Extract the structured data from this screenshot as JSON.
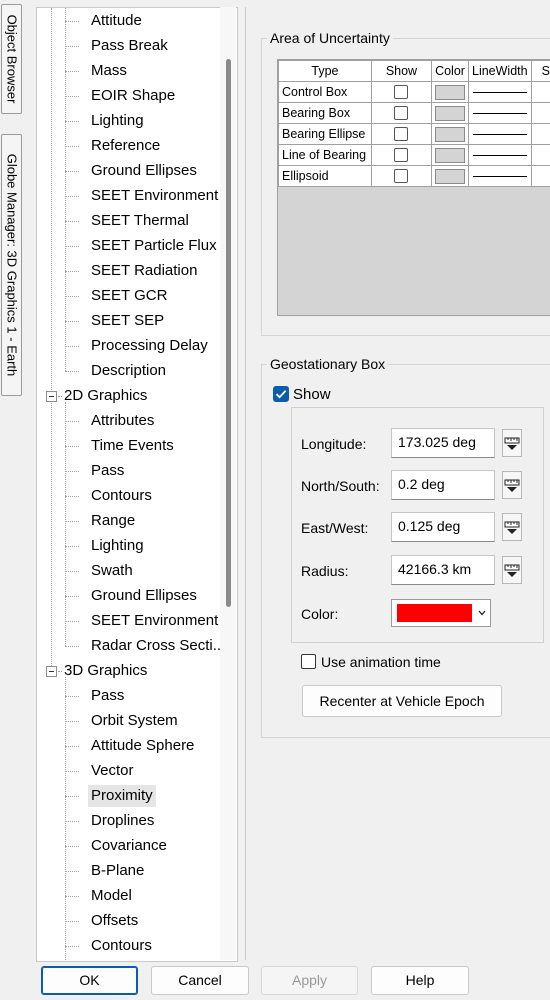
{
  "side_tabs": [
    "Object Browser",
    "Globe Manager: 3D Graphics 1 - Earth"
  ],
  "tree": {
    "items": [
      {
        "label": "Attitude",
        "level": 1
      },
      {
        "label": "Pass Break",
        "level": 1
      },
      {
        "label": "Mass",
        "level": 1
      },
      {
        "label": "EOIR Shape",
        "level": 1
      },
      {
        "label": "Lighting",
        "level": 1
      },
      {
        "label": "Reference",
        "level": 1
      },
      {
        "label": "Ground Ellipses",
        "level": 1
      },
      {
        "label": "SEET Environment",
        "level": 1
      },
      {
        "label": "SEET Thermal",
        "level": 1
      },
      {
        "label": "SEET Particle Flux",
        "level": 1
      },
      {
        "label": "SEET Radiation",
        "level": 1
      },
      {
        "label": "SEET GCR",
        "level": 1
      },
      {
        "label": "SEET SEP",
        "level": 1
      },
      {
        "label": "Processing Delay",
        "level": 1
      },
      {
        "label": "Description",
        "level": 1
      },
      {
        "label": "2D Graphics",
        "level": 0
      },
      {
        "label": "Attributes",
        "level": 1
      },
      {
        "label": "Time Events",
        "level": 1
      },
      {
        "label": "Pass",
        "level": 1
      },
      {
        "label": "Contours",
        "level": 1
      },
      {
        "label": "Range",
        "level": 1
      },
      {
        "label": "Lighting",
        "level": 1
      },
      {
        "label": "Swath",
        "level": 1
      },
      {
        "label": "Ground Ellipses",
        "level": 1
      },
      {
        "label": "SEET Environment",
        "level": 1
      },
      {
        "label": "Radar Cross Secti...",
        "level": 1
      },
      {
        "label": "3D Graphics",
        "level": 0
      },
      {
        "label": "Pass",
        "level": 1
      },
      {
        "label": "Orbit System",
        "level": 1
      },
      {
        "label": "Attitude Sphere",
        "level": 1
      },
      {
        "label": "Vector",
        "level": 1
      },
      {
        "label": "Proximity",
        "level": 1,
        "selected": true
      },
      {
        "label": "Droplines",
        "level": 1
      },
      {
        "label": "Covariance",
        "level": 1
      },
      {
        "label": "B-Plane",
        "level": 1
      },
      {
        "label": "Model",
        "level": 1
      },
      {
        "label": "Offsets",
        "level": 1
      },
      {
        "label": "Contours",
        "level": 1
      }
    ]
  },
  "uncertainty": {
    "title": "Area of Uncertainty",
    "columns": [
      "Type",
      "Show",
      "Color",
      "LineWidth",
      "Sh"
    ],
    "rows": [
      "Control Box",
      "Bearing Box",
      "Bearing Ellipse",
      "Line of Bearing",
      "Ellipsoid"
    ]
  },
  "geo": {
    "title": "Geostationary Box",
    "show_label": "Show",
    "show_checked": true,
    "fields": [
      {
        "label": "Longitude:",
        "value": "173.025 deg"
      },
      {
        "label": "North/South:",
        "value": "0.2 deg"
      },
      {
        "label": "East/West:",
        "value": "0.125 deg"
      },
      {
        "label": "Radius:",
        "value": "42166.3 km"
      }
    ],
    "color_label": "Color:",
    "color_value": "#ff0000",
    "anim_label": "Use animation time",
    "anim_checked": false,
    "recenter_label": "Recenter at Vehicle Epoch"
  },
  "buttons": {
    "ok": "OK",
    "cancel": "Cancel",
    "apply": "Apply",
    "help": "Help"
  }
}
